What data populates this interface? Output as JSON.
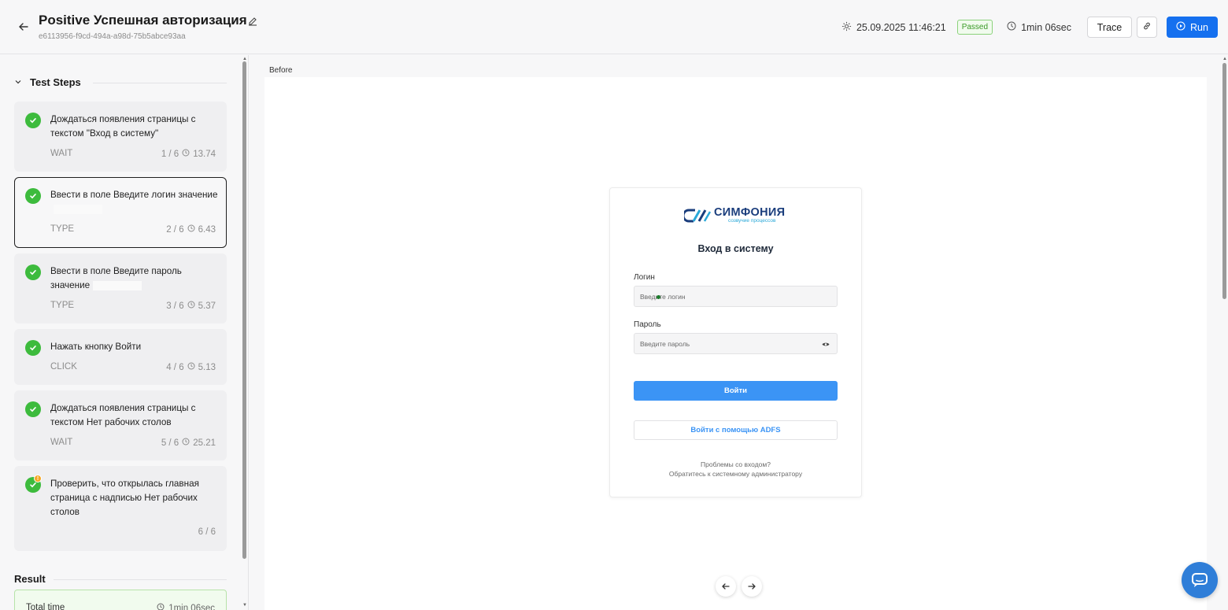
{
  "header": {
    "title": "Positive Успешная авторизация",
    "uuid": "e6113956-f9cd-494a-a98d-75b5abce93aa",
    "date": "25.09.2025 11:46:21",
    "status": "Passed",
    "duration": "1min 06sec",
    "trace_label": "Trace",
    "run_label": "Run"
  },
  "sidebar": {
    "section_title": "Test Steps",
    "steps": [
      {
        "text": "Дождаться появления страницы с текстом \"Вход в систему\"",
        "type": "WAIT",
        "counter": "1 / 6",
        "time": "13.74"
      },
      {
        "text": "Ввести в поле Введите логин значение",
        "type": "TYPE",
        "counter": "2 / 6",
        "time": "6.43"
      },
      {
        "text": "Ввести в поле Введите пароль значение",
        "type": "TYPE",
        "counter": "3 / 6",
        "time": "5.37"
      },
      {
        "text": "Нажать кнопку Войти",
        "type": "CLICK",
        "counter": "4 / 6",
        "time": "5.13"
      },
      {
        "text": "Дождаться появления страницы с текстом Нет рабочих столов",
        "type": "WAIT",
        "counter": "5 / 6",
        "time": "25.21"
      },
      {
        "text": "Проверить, что открылась главная страница с надписью Нет рабочих столов",
        "type": "",
        "counter": "6 / 6",
        "time": ""
      }
    ],
    "result_title": "Result",
    "total_time_label": "Total time",
    "total_time_value": "1min 06sec"
  },
  "main": {
    "before_label": "Before",
    "login": {
      "logo_main": "СИМФОНИЯ",
      "logo_sub": "созвучие процессов",
      "title": "Вход в систему",
      "login_label": "Логин",
      "login_placeholder": "Введите логин",
      "password_label": "Пароль",
      "password_placeholder": "Введите пароль",
      "submit_label": "Войти",
      "adfs_label": "Войти с помощью ADFS",
      "help_line1": "Проблемы со входом?",
      "help_line2": "Обратитесь к системному администратору"
    }
  },
  "colors": {
    "accent": "#1570ef",
    "success": "#3dbb3d",
    "brand_blue": "#1a3d7c",
    "brand_cyan": "#2aa8d8"
  }
}
